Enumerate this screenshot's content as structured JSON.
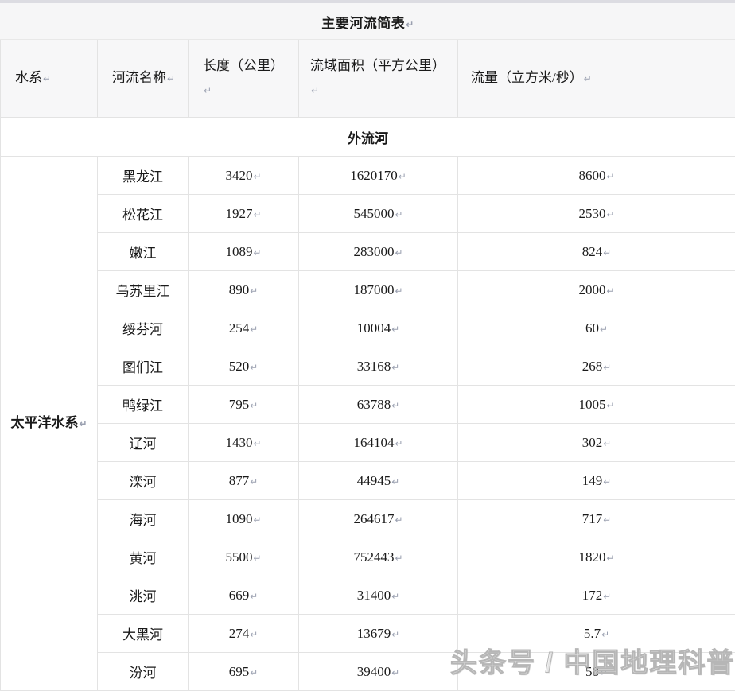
{
  "document": {
    "title": "主要河流简表",
    "title_mark": "↵"
  },
  "table": {
    "columns": [
      {
        "key": "system",
        "label": "水系",
        "mark": "↵"
      },
      {
        "key": "river",
        "label": "河流名称",
        "mark": "↵"
      },
      {
        "key": "length",
        "label": "长度（公里）",
        "mark": "↵"
      },
      {
        "key": "area",
        "label": "流域面积（平方公里）",
        "mark": "↵"
      },
      {
        "key": "flow",
        "label": "流量（立方米/秒）",
        "mark": "↵"
      }
    ],
    "section_label": "外流河",
    "system_label": "太平洋水系",
    "system_mark": "↵",
    "rows": [
      {
        "river": "黑龙江",
        "length": "3420",
        "area": "1620170",
        "flow": "8600"
      },
      {
        "river": "松花江",
        "length": "1927",
        "area": "545000",
        "flow": "2530"
      },
      {
        "river": "嫩江",
        "length": "1089",
        "area": "283000",
        "flow": "824"
      },
      {
        "river": "乌苏里江",
        "length": "890",
        "area": "187000",
        "flow": "2000"
      },
      {
        "river": "绥芬河",
        "length": "254",
        "area": "10004",
        "flow": "60"
      },
      {
        "river": "图们江",
        "length": "520",
        "area": "33168",
        "flow": "268"
      },
      {
        "river": "鸭绿江",
        "length": "795",
        "area": "63788",
        "flow": "1005"
      },
      {
        "river": "辽河",
        "length": "1430",
        "area": "164104",
        "flow": "302"
      },
      {
        "river": "滦河",
        "length": "877",
        "area": "44945",
        "flow": "149"
      },
      {
        "river": "海河",
        "length": "1090",
        "area": "264617",
        "flow": "717"
      },
      {
        "river": "黄河",
        "length": "5500",
        "area": "752443",
        "flow": "1820"
      },
      {
        "river": "洮河",
        "length": "669",
        "area": "31400",
        "flow": "172"
      },
      {
        "river": "大黑河",
        "length": "274",
        "area": "13679",
        "flow": "5.7"
      },
      {
        "river": "汾河",
        "length": "695",
        "area": "39400",
        "flow": "58"
      }
    ],
    "cell_mark": "↵"
  },
  "watermark": {
    "text": "头条号 / 中国地理科普"
  },
  "colors": {
    "header_background": "#f7f7f8",
    "title_background": "#f6f6f7",
    "border": "#e3e3e3",
    "text": "#1a1a1a",
    "page_edge": "#dcdce2"
  }
}
